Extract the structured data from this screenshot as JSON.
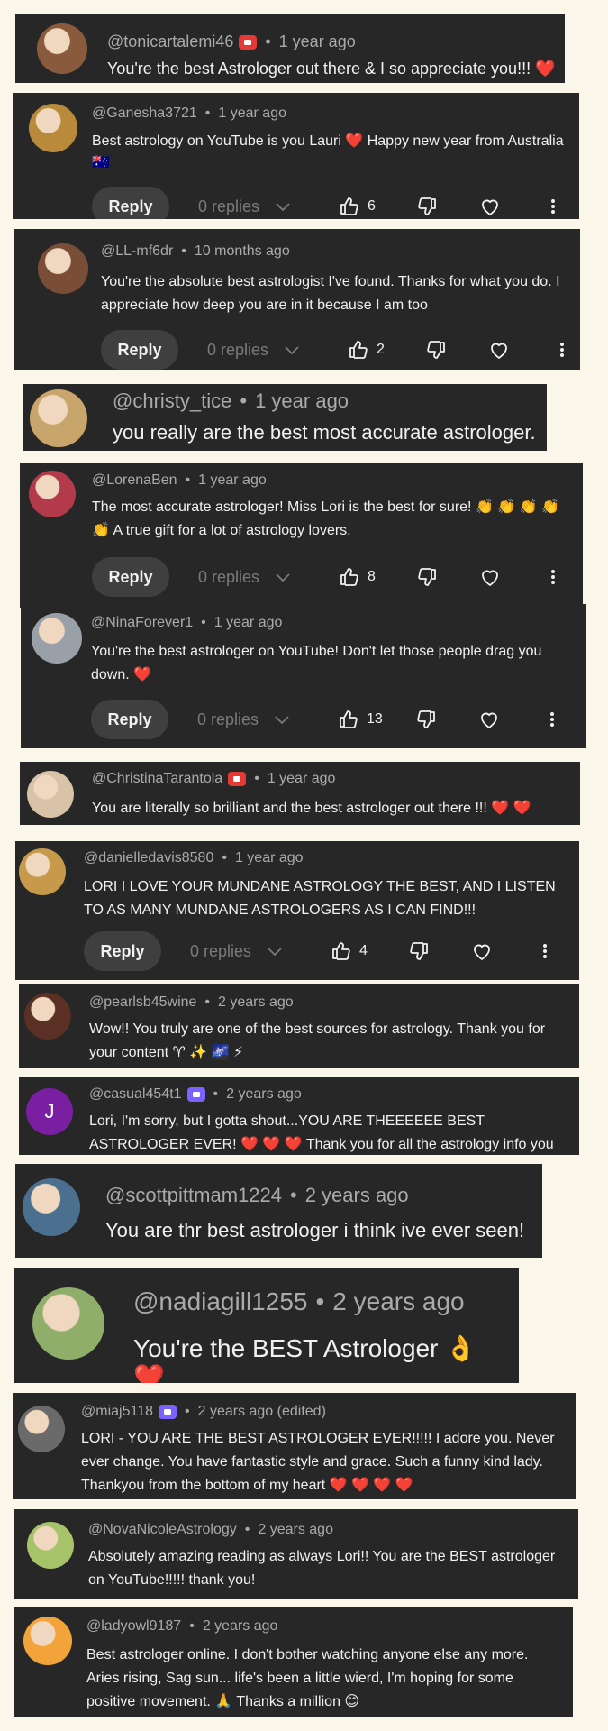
{
  "comments": [
    {
      "handle": "@tonicartalemi46",
      "badge": "red",
      "time": "1 year ago",
      "text": "You're the best Astrologer out there & I so appreciate you!!!",
      "emoji": "❤️",
      "avatar_color": "#8a5a3c"
    },
    {
      "handle": "@Ganesha3721",
      "time": "1 year ago",
      "text": "Best astrology on YouTube is you Lauri ❤️ Happy new year from Australia 🇦🇺",
      "emoji_flag": "AU",
      "reply": "Reply",
      "replies": "0 replies",
      "likes": "6",
      "avatar_color": "#b98a3a"
    },
    {
      "handle": "@LL-mf6dr",
      "time": "10 months ago",
      "text": "You're the absolute best astrologist I've found. Thanks for what you do. I appreciate how deep you are in it because I am too",
      "reply": "Reply",
      "replies": "0 replies",
      "likes": "2",
      "avatar_color": "#7a4d36"
    },
    {
      "handle": "@christy_tice",
      "time": "1 year ago",
      "text": "you really are the best most accurate astrologer.",
      "avatar_color": "#c8a56a"
    },
    {
      "handle": "@LorenaBen",
      "time": "1 year ago",
      "text": "The most accurate astrologer! Miss Lori is the best for sure! 👏 👏 👏 👏 👏 A true gift for a lot of astrology lovers.",
      "reply": "Reply",
      "replies": "0 replies",
      "likes": "8",
      "avatar_color": "#b33a4a"
    },
    {
      "handle": "@NinaForever1",
      "time": "1 year ago",
      "text": "You're the best astrologer on YouTube! Don't let those people drag you down. ❤️",
      "reply": "Reply",
      "replies": "0 replies",
      "likes": "13",
      "avatar_color": "#9aa0a8"
    },
    {
      "handle": "@ChristinaTarantola",
      "badge": "red",
      "time": "1 year ago",
      "text": "You are literally so brilliant and the best astrologer out there !!! ❤️ ❤️",
      "avatar_color": "#d8c2a8"
    },
    {
      "handle": "@danielledavis8580",
      "time": "1 year ago",
      "text": "LORI I LOVE YOUR MUNDANE ASTROLOGY THE BEST, AND I LISTEN TO AS MANY MUNDANE ASTROLOGERS AS I CAN FIND!!!",
      "reply": "Reply",
      "replies": "0 replies",
      "likes": "4",
      "avatar_color": "#c69a4a"
    },
    {
      "handle": "@pearlsb45wine",
      "time": "2 years ago",
      "text": "Wow!! You truly are one of the best sources for astrology. Thank you for your content ♈ ✨ 🌌 ⚡",
      "avatar_color": "#5a2f24"
    },
    {
      "handle": "@casual454t1",
      "badge": "purple",
      "time": "2 years ago",
      "text": "Lori, I'm sorry, but I gotta shout...YOU ARE THEEEEEE BEST ASTROLOGER EVER! ❤️ ❤️ ❤️ Thank you for all the astrology info you provide. I am",
      "avatar_letter": "J",
      "avatar_color": "#7b1fa2"
    },
    {
      "handle": "@scottpittmam1224",
      "time": "2 years ago",
      "text": "You are thr best astrologer i think ive ever seen!",
      "avatar_color": "#4a6f8f"
    },
    {
      "handle": "@nadiagill1255",
      "time": "2 years ago",
      "text": "You're the BEST Astrologer 👌 ❤️",
      "avatar_color": "#8fae6a"
    },
    {
      "handle": "@miaj5118",
      "badge": "purple",
      "time": "2 years ago (edited)",
      "text": "LORI - YOU ARE THE BEST ASTROLOGER EVER!!!!! I adore you. Never ever change. You have fantastic style and grace. Such a funny kind lady. Thankyou from the bottom of my heart ❤️ ❤️ ❤️ ❤️",
      "avatar_color": "#6a6a6a"
    },
    {
      "handle": "@NovaNicoleAstrology",
      "time": "2 years ago",
      "text": "Absolutely amazing reading as always Lori!! You are the BEST astrologer on YouTube!!!!! thank you!",
      "avatar_color": "#a6c36a"
    },
    {
      "handle": "@ladyowl9187",
      "time": "2 years ago",
      "text": "Best astrologer online. I don't bother watching anyone else any more. Aries rising, Sag sun... life's been a little wierd, I'm hoping for some positive movement. 🙏 Thanks a million 😊",
      "avatar_color": "#f2a43a"
    }
  ],
  "icons": {
    "like": "thumbs-up-icon",
    "dislike": "thumbs-down-icon",
    "heart": "heart-outline-icon",
    "more": "more-vertical-icon",
    "chevron": "chevron-down-icon",
    "badge": "member-badge-icon"
  }
}
